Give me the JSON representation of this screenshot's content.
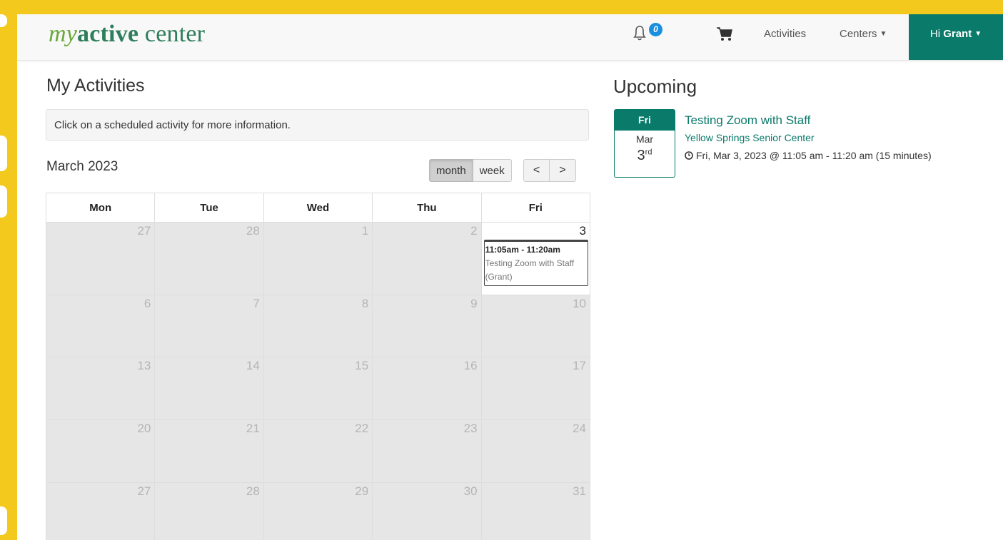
{
  "brand": {
    "my": "my",
    "active": "active",
    "center": "center"
  },
  "navbar": {
    "notifications_count": "0",
    "activities": "Activities",
    "centers": "Centers",
    "user_greeting": "Hi",
    "user_name": "Grant",
    "accent_color": "#0a7a6a"
  },
  "my_activities": {
    "heading": "My Activities",
    "info": "Click on a scheduled activity for more information.",
    "month_title": "March 2023",
    "views": {
      "month": "month",
      "week": "week",
      "selected": "month"
    },
    "prev": "<",
    "next": ">",
    "weekdays": [
      "Mon",
      "Tue",
      "Wed",
      "Thu",
      "Fri"
    ],
    "weeks": [
      [
        "27",
        "28",
        "1",
        "2",
        "3"
      ],
      [
        "6",
        "7",
        "8",
        "9",
        "10"
      ],
      [
        "13",
        "14",
        "15",
        "16",
        "17"
      ],
      [
        "20",
        "21",
        "22",
        "23",
        "24"
      ],
      [
        "27",
        "28",
        "29",
        "30",
        "31"
      ]
    ],
    "event": {
      "time": "11:05am - 11:20am",
      "title": "Testing Zoom with Staff",
      "who": "(Grant)"
    }
  },
  "upcoming": {
    "heading": "Upcoming",
    "dow": "Fri",
    "month": "Mar",
    "day": "3",
    "day_suffix": "rd",
    "title": "Testing Zoom with Staff",
    "center": "Yellow Springs Senior Center",
    "time": "Fri, Mar 3, 2023 @ 11:05 am - 11:20 am (15 minutes)"
  }
}
